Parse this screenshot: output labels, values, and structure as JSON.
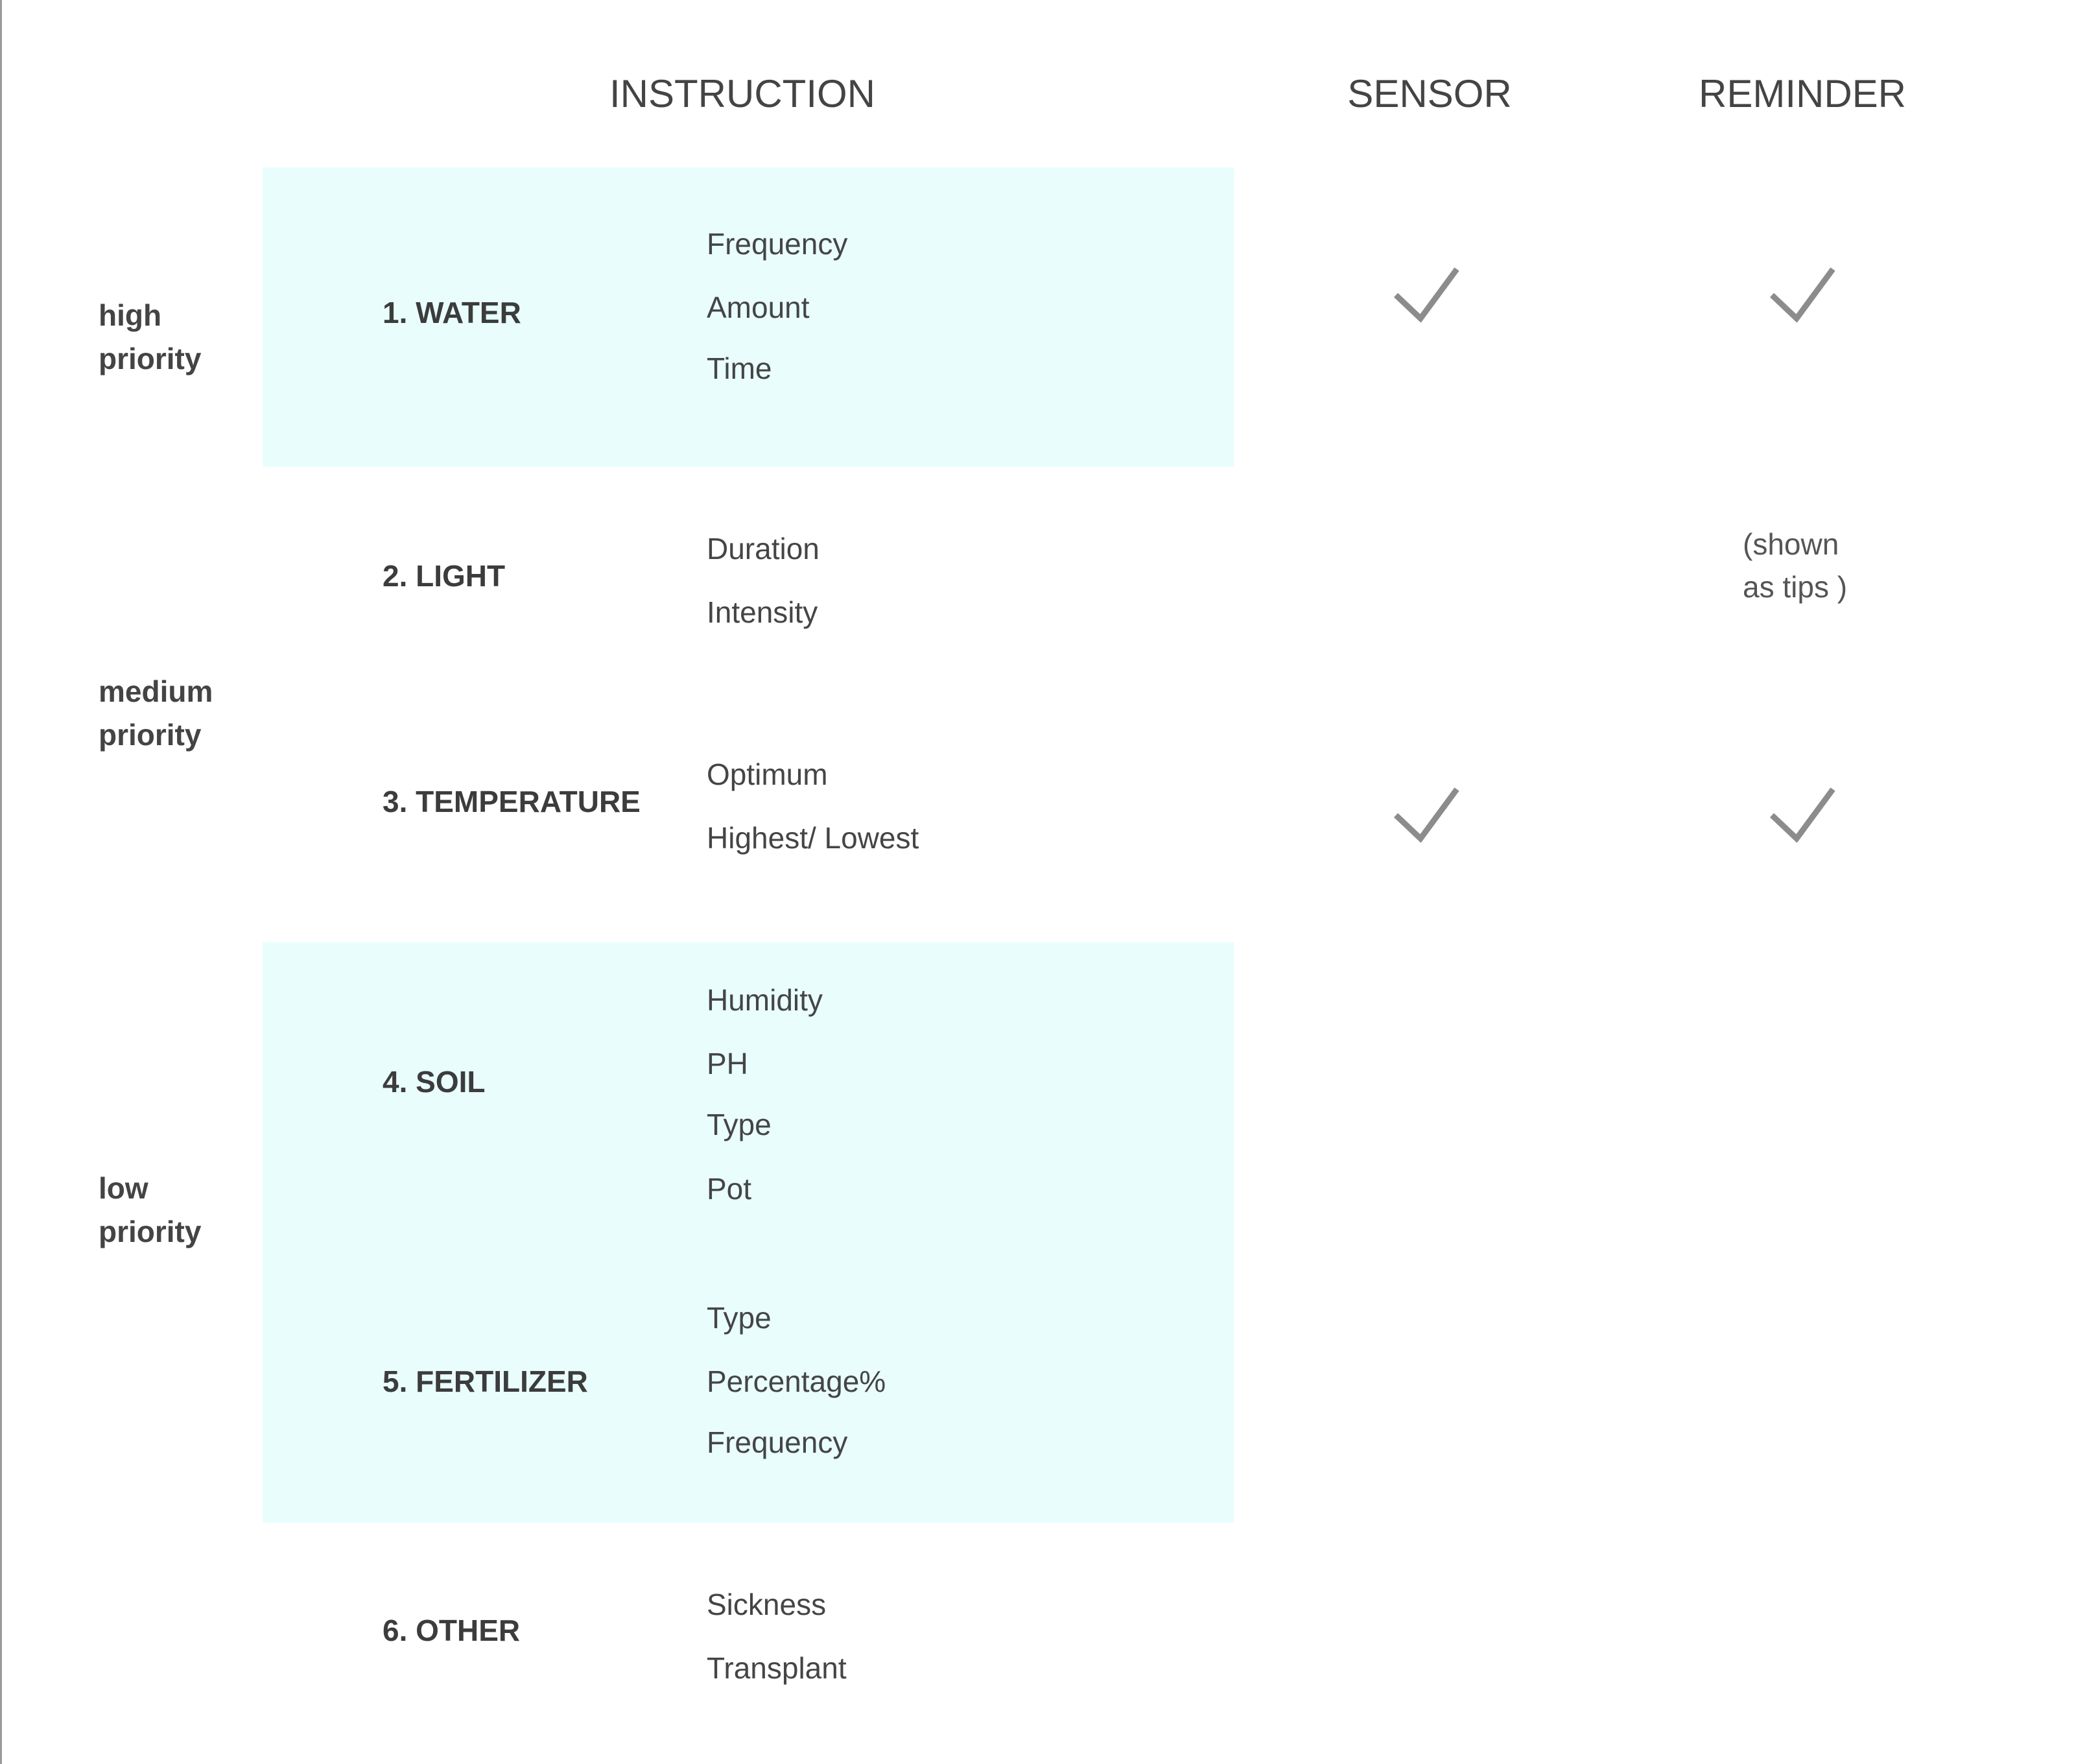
{
  "headers": {
    "instruction": "INSTRUCTION",
    "sensor": "SENSOR",
    "reminder": "REMINDER"
  },
  "priorities": {
    "high": [
      "high",
      "priority"
    ],
    "medium": [
      "medium",
      "priority"
    ],
    "low": [
      "low",
      "priority"
    ]
  },
  "categories": [
    {
      "label": "1. WATER",
      "items": [
        "Frequency",
        "Amount",
        "Time"
      ],
      "sensor": true,
      "reminder": true
    },
    {
      "label": "2. LIGHT",
      "items": [
        "Duration",
        "Intensity"
      ],
      "sensor": false,
      "reminder": false,
      "reminder_note": [
        "(shown",
        "as tips )"
      ]
    },
    {
      "label": "3. TEMPERATURE",
      "items": [
        "Optimum",
        "Highest/ Lowest"
      ],
      "sensor": true,
      "reminder": true
    },
    {
      "label": "4. SOIL",
      "items": [
        "Humidity",
        "PH",
        "Type",
        "Pot"
      ],
      "sensor": false,
      "reminder": false
    },
    {
      "label": "5. FERTILIZER",
      "items": [
        "Type",
        "Percentage%",
        "Frequency"
      ],
      "sensor": false,
      "reminder": false
    },
    {
      "label": "6. OTHER",
      "items": [
        "Sickness",
        "Transplant"
      ],
      "sensor": false,
      "reminder": false
    }
  ],
  "icons": {
    "check": "checkmark-icon"
  },
  "colors": {
    "highlight_band": "#e9fdfd",
    "check": "#8c8c8c",
    "text": "#3c3c3c"
  }
}
